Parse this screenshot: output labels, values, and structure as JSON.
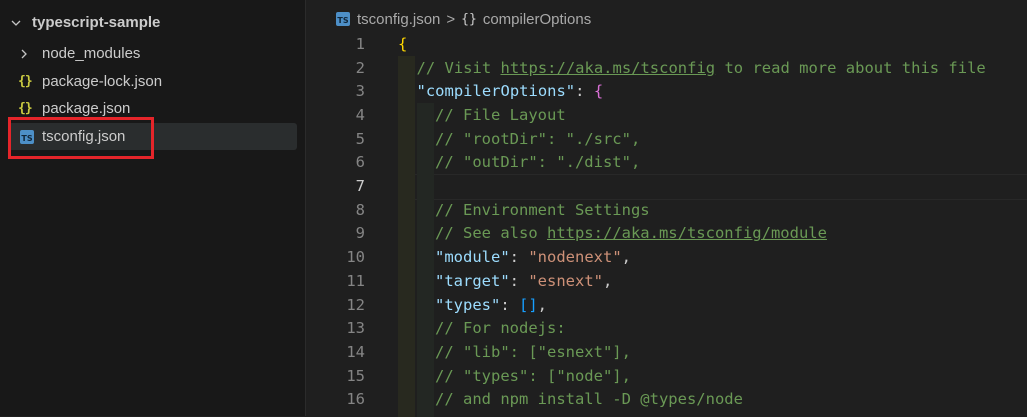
{
  "explorer": {
    "root_label": "typescript-sample",
    "items": [
      {
        "label": "node_modules",
        "type": "folder"
      },
      {
        "label": "package-lock.json",
        "type": "json"
      },
      {
        "label": "package.json",
        "type": "json"
      },
      {
        "label": "tsconfig.json",
        "type": "ts",
        "selected": true
      }
    ],
    "json_icon_glyph": "{}",
    "ts_icon_glyph": "TS"
  },
  "breadcrumb": {
    "file": "tsconfig.json",
    "separator": ">",
    "braces_glyph": "{}",
    "symbol": "compilerOptions"
  },
  "editor": {
    "line_numbers": [
      "1",
      "2",
      "3",
      "4",
      "5",
      "6",
      "7",
      "8",
      "9",
      "10",
      "11",
      "12",
      "13",
      "14",
      "15",
      "16"
    ],
    "active_line": 7,
    "lines": [
      [
        {
          "t": "{",
          "c": "brace1"
        }
      ],
      [
        {
          "t": "// Visit ",
          "c": "comment"
        },
        {
          "t": "https://aka.ms/tsconfig",
          "c": "comment link"
        },
        {
          "t": " to read more about this file",
          "c": "comment"
        }
      ],
      [
        {
          "t": "\"compilerOptions\"",
          "c": "key"
        },
        {
          "t": ": ",
          "c": "punct"
        },
        {
          "t": "{",
          "c": "brace2"
        }
      ],
      [
        {
          "t": "// File Layout",
          "c": "comment"
        }
      ],
      [
        {
          "t": "// \"rootDir\": \"./src\",",
          "c": "comment"
        }
      ],
      [
        {
          "t": "// \"outDir\": \"./dist\",",
          "c": "comment"
        }
      ],
      [],
      [
        {
          "t": "// Environment Settings",
          "c": "comment"
        }
      ],
      [
        {
          "t": "// See also ",
          "c": "comment"
        },
        {
          "t": "https://aka.ms/tsconfig/module",
          "c": "comment link"
        }
      ],
      [
        {
          "t": "\"module\"",
          "c": "key"
        },
        {
          "t": ": ",
          "c": "punct"
        },
        {
          "t": "\"nodenext\"",
          "c": "str"
        },
        {
          "t": ",",
          "c": "punct"
        }
      ],
      [
        {
          "t": "\"target\"",
          "c": "key"
        },
        {
          "t": ": ",
          "c": "punct"
        },
        {
          "t": "\"esnext\"",
          "c": "str"
        },
        {
          "t": ",",
          "c": "punct"
        }
      ],
      [
        {
          "t": "\"types\"",
          "c": "key"
        },
        {
          "t": ": ",
          "c": "punct"
        },
        {
          "t": "[]",
          "c": "bracket3"
        },
        {
          "t": ",",
          "c": "punct"
        }
      ],
      [
        {
          "t": "// For nodejs:",
          "c": "comment"
        }
      ],
      [
        {
          "t": "// \"lib\": [\"esnext\"],",
          "c": "comment"
        }
      ],
      [
        {
          "t": "// \"types\": [\"node\"],",
          "c": "comment"
        }
      ],
      [
        {
          "t": "// and npm install -D @types/node",
          "c": "comment"
        }
      ]
    ],
    "indent_levels": [
      0,
      1,
      1,
      2,
      2,
      2,
      2,
      2,
      2,
      2,
      2,
      2,
      2,
      2,
      2,
      2
    ]
  },
  "colors": {
    "highlight_box": "#e5252a",
    "background": "#1f1f1f",
    "sidebar_bg": "#181818"
  }
}
